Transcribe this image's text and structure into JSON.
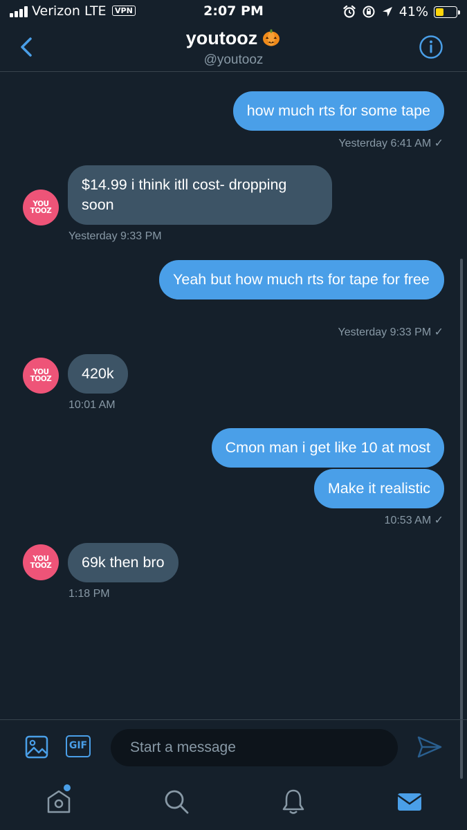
{
  "status_bar": {
    "carrier": "Verizon LTE",
    "vpn": "VPN",
    "time": "2:07 PM",
    "battery": "41%",
    "battery_level": 0.41
  },
  "header": {
    "name": "youtooz",
    "handle": "@youtooz",
    "emoji": "pumpkin"
  },
  "contact": {
    "avatar_text_line1": "YOU",
    "avatar_text_line2": "TOOZ"
  },
  "messages": [
    {
      "side": "sent",
      "text": "how much rts for some tape",
      "timestamp": "Yesterday 6:41 AM ✓"
    },
    {
      "side": "recv",
      "text": "$14.99 i think itll cost- dropping soon",
      "timestamp": "Yesterday 9:33 PM"
    },
    {
      "side": "sent",
      "text": "Yeah but how much rts for tape for free",
      "timestamp": "Yesterday 9:33 PM ✓"
    },
    {
      "side": "recv",
      "text": "420k",
      "timestamp": "10:01 AM"
    },
    {
      "side": "sent",
      "text": "Cmon man i get like 10 at most",
      "timestamp": ""
    },
    {
      "side": "sent",
      "text": "Make it realistic",
      "timestamp": "10:53 AM ✓"
    },
    {
      "side": "recv",
      "text": "69k then bro",
      "timestamp": "1:18 PM"
    }
  ],
  "composer": {
    "gif_label": "GIF",
    "placeholder": "Start a message"
  },
  "colors": {
    "background": "#15202b",
    "accent": "#4a9fe8",
    "received_bubble": "#3d5466",
    "avatar": "#ee5478",
    "muted_text": "#8899a6"
  }
}
